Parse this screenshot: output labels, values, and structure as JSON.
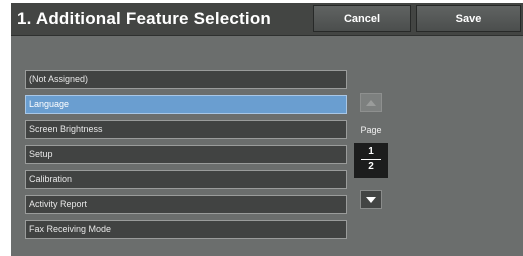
{
  "header": {
    "title": "1. Additional Feature Selection",
    "cancel_label": "Cancel",
    "save_label": "Save"
  },
  "feature_list": {
    "items": [
      {
        "label": "(Not Assigned)",
        "selected": false
      },
      {
        "label": "Language",
        "selected": true
      },
      {
        "label": "Screen Brightness",
        "selected": false
      },
      {
        "label": "Setup",
        "selected": false
      },
      {
        "label": "Calibration",
        "selected": false
      },
      {
        "label": "Activity Report",
        "selected": false
      },
      {
        "label": "Fax Receiving Mode",
        "selected": false
      }
    ]
  },
  "pager": {
    "label": "Page",
    "current": "1",
    "total": "2",
    "up_icon": "triangle-up-icon",
    "down_icon": "triangle-down-icon"
  },
  "colors": {
    "background": "#6b6e6d",
    "title_bar": "#434543",
    "item": "#414342",
    "selected_item": "#6a9ed0"
  }
}
